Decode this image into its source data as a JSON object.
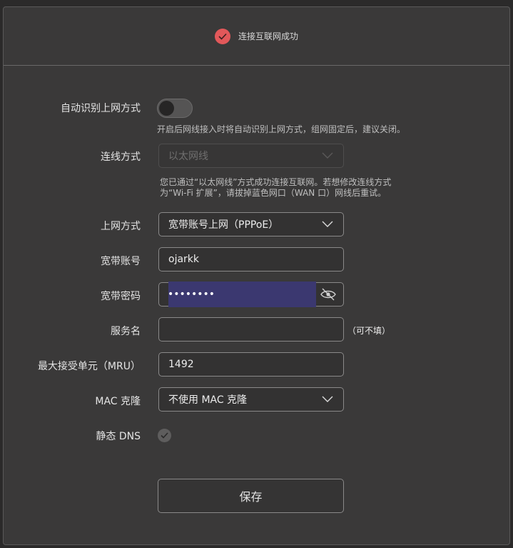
{
  "status": {
    "text": "连接互联网成功"
  },
  "auto_detect": {
    "label": "自动识别上网方式",
    "enabled": false,
    "hint": "开启后网线接入时将自动识别上网方式，组网固定后，建议关闭。"
  },
  "connection_type": {
    "label": "连线方式",
    "value": "以太网线",
    "hint_line1": "您已通过“以太网线”方式成功连接互联网。若想修改连线方式",
    "hint_line2": "为“Wi-Fi 扩展”，请拔掉蓝色网口（WAN 口）网线后重试。"
  },
  "internet_mode": {
    "label": "上网方式",
    "value": "宽带账号上网（PPPoE）"
  },
  "account": {
    "label": "宽带账号",
    "value": "ojarkk"
  },
  "password": {
    "label": "宽带密码",
    "value": "••••••••"
  },
  "service_name": {
    "label": "服务名",
    "value": "",
    "optional": "（可不填）"
  },
  "mru": {
    "label": "最大接受单元（MRU）",
    "value": "1492"
  },
  "mac_clone": {
    "label": "MAC 克隆",
    "value": "不使用 MAC 克隆"
  },
  "static_dns": {
    "label": "静态 DNS",
    "checked": true
  },
  "save": {
    "label": "保存"
  },
  "colors": {
    "accent": "#e2585a",
    "selection": "#3b3870",
    "background": "#3a3939"
  },
  "icons": [
    "check-icon",
    "chevron-down-icon",
    "eye-hidden-icon"
  ]
}
